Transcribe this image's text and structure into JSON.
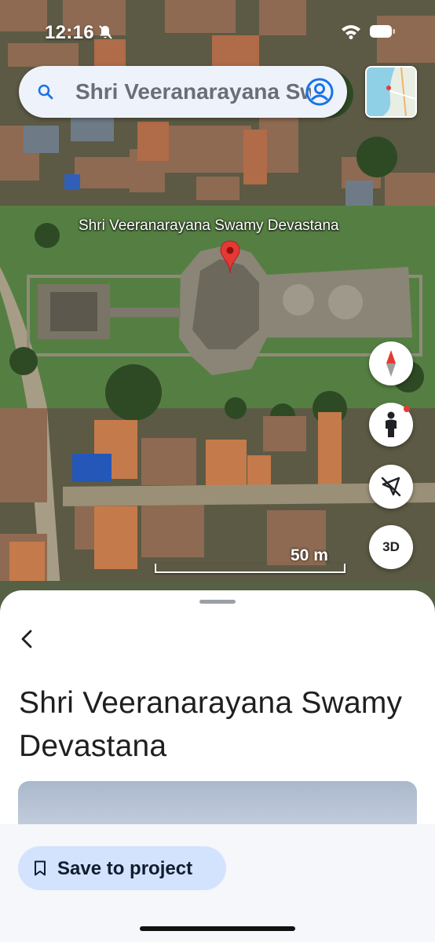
{
  "status_bar": {
    "time": "12:16"
  },
  "search": {
    "query": "Shri Veeranarayana Swamy Devastana"
  },
  "map": {
    "place_label": "Shri Veeranarayana Swamy Devastana",
    "scale_label": "50 m",
    "controls": {
      "view_3d_label": "3D"
    },
    "icons": [
      "search-icon",
      "account-icon",
      "pin-icon",
      "compass-icon",
      "pegman-icon",
      "location-off-icon",
      "bell-off-icon",
      "wifi-icon",
      "battery-icon"
    ]
  },
  "sheet": {
    "title": "Shri Veeranarayana Swamy Devastana",
    "save_button_label": "Save to project"
  },
  "colors": {
    "accent": "#1a73e8",
    "pin": "#e53935",
    "save_button_bg": "#d3e3fd"
  }
}
